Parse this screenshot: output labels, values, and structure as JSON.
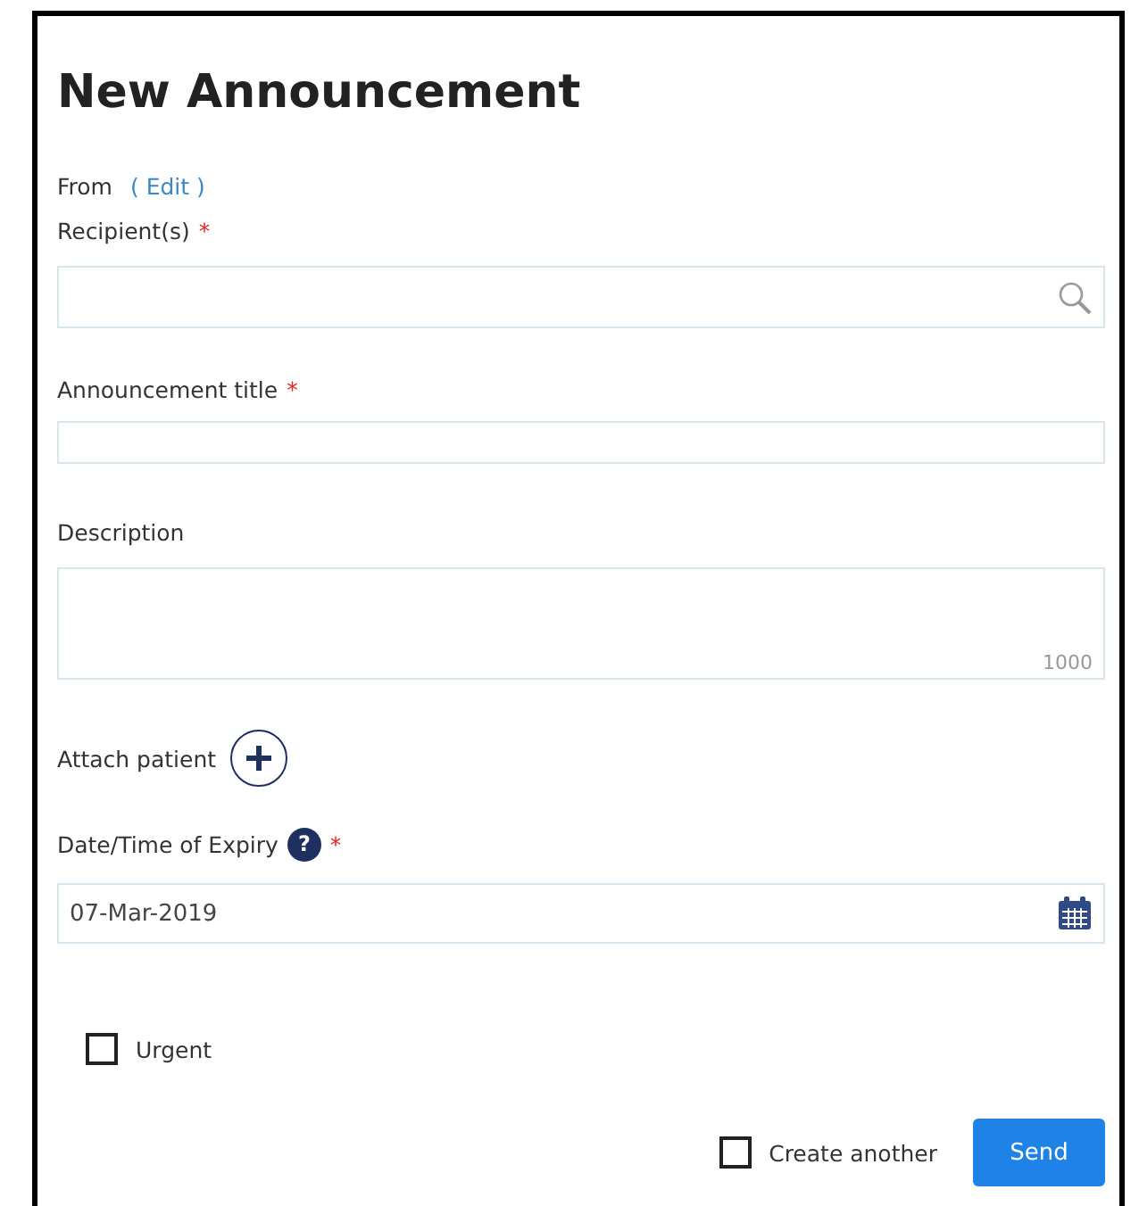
{
  "title": "New Announcement",
  "from": {
    "label": "From",
    "link": "( Edit )"
  },
  "fields": [
    {
      "kind": "search",
      "label": "Recipient(s)",
      "required_mark": "*"
    },
    {
      "kind": "text",
      "label": "Announcement title",
      "required_mark": "*"
    },
    {
      "kind": "textarea",
      "label": "Description",
      "counter": "1000"
    },
    {
      "kind": "attach",
      "label": "Attach patient"
    },
    {
      "kind": "date",
      "label": "Date/Time of Expiry",
      "required_mark": "*",
      "help": "?",
      "value": "07-Mar-2019"
    }
  ],
  "urgent": {
    "label": "Urgent",
    "checked": false
  },
  "create_another": {
    "label": "Create another",
    "checked": false
  },
  "send_button": "Send"
}
